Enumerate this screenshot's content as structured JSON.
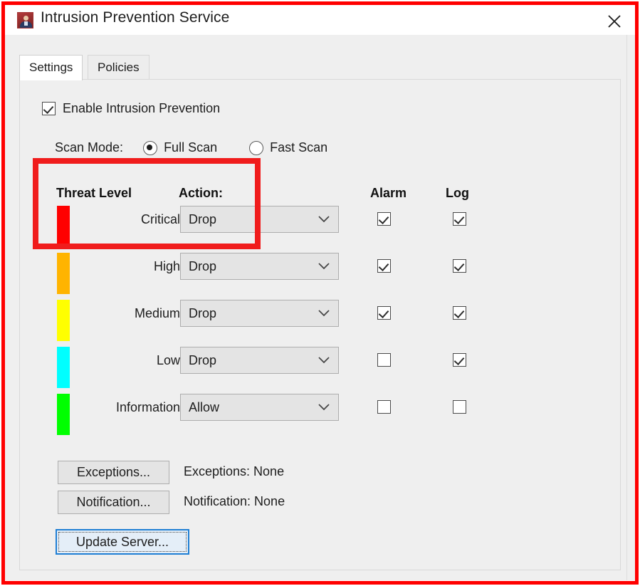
{
  "window": {
    "title": "Intrusion Prevention Service",
    "icon": "ips-shield-person-icon",
    "close_label": "✕",
    "accent_annotation_color": "#FF0000",
    "body_color": "#EFEFEF"
  },
  "tabs": [
    {
      "label": "Settings",
      "active": true
    },
    {
      "label": "Policies",
      "active": false
    }
  ],
  "settings": {
    "enable": {
      "label": "Enable Intrusion Prevention",
      "checked": true
    },
    "scan_mode": {
      "label": "Scan Mode:",
      "options": [
        {
          "label": "Full Scan",
          "selected": true
        },
        {
          "label": "Fast Scan",
          "selected": false
        }
      ]
    },
    "table": {
      "headers": {
        "threat_level": "Threat Level",
        "action": "Action:",
        "alarm": "Alarm",
        "log": "Log"
      },
      "rows": [
        {
          "level": "Critical",
          "color": "#FF0000",
          "action": "Drop",
          "alarm": true,
          "log": true
        },
        {
          "level": "High",
          "color": "#FFB400",
          "action": "Drop",
          "alarm": true,
          "log": true
        },
        {
          "level": "Medium",
          "color": "#FFFF00",
          "action": "Drop",
          "alarm": true,
          "log": true
        },
        {
          "level": "Low",
          "color": "#00FFFF",
          "action": "Drop",
          "alarm": false,
          "log": true
        },
        {
          "level": "Information",
          "color": "#00FF00",
          "action": "Allow",
          "alarm": false,
          "log": false
        }
      ]
    },
    "buttons": {
      "exceptions": "Exceptions...",
      "notification": "Notification...",
      "update_server": "Update Server..."
    },
    "status": {
      "exceptions": "Exceptions: None",
      "notification": "Notification: None"
    }
  }
}
